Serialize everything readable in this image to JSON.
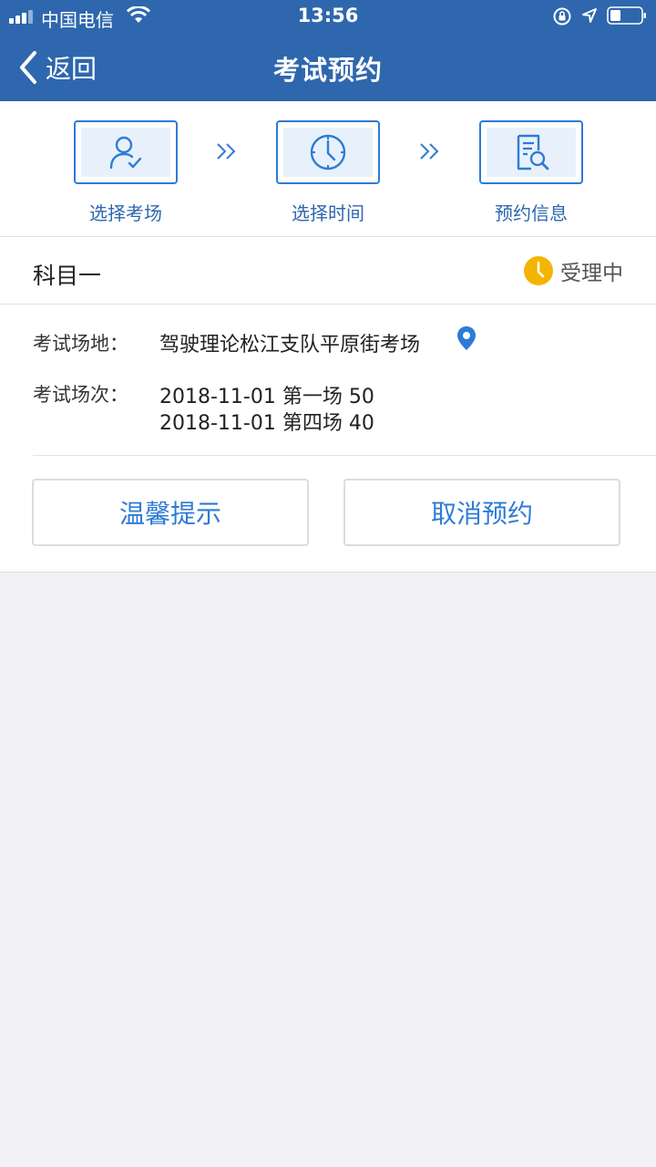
{
  "status_bar": {
    "carrier": "中国电信",
    "time": "13:56"
  },
  "nav": {
    "back_label": "返回",
    "title": "考试预约"
  },
  "steps": [
    {
      "label": "选择考场",
      "icon": "user-check-icon"
    },
    {
      "label": "选择时间",
      "icon": "clock-icon"
    },
    {
      "label": "预约信息",
      "icon": "document-search-icon"
    }
  ],
  "appointment": {
    "subject": "科目一",
    "status": "受理中",
    "venue_label": "考试场地：",
    "venue_value": "驾驶理论松江支队平原街考场",
    "session_label": "考试场次：",
    "sessions": [
      "2018-11-01 第一场 50",
      "2018-11-01 第四场 40"
    ]
  },
  "buttons": {
    "tips": "温馨提示",
    "cancel": "取消预约"
  },
  "colors": {
    "header_bg": "#2e67ad",
    "accent": "#2e7bd6",
    "status_icon": "#f5b400",
    "page_bg": "#f2f2f6"
  }
}
